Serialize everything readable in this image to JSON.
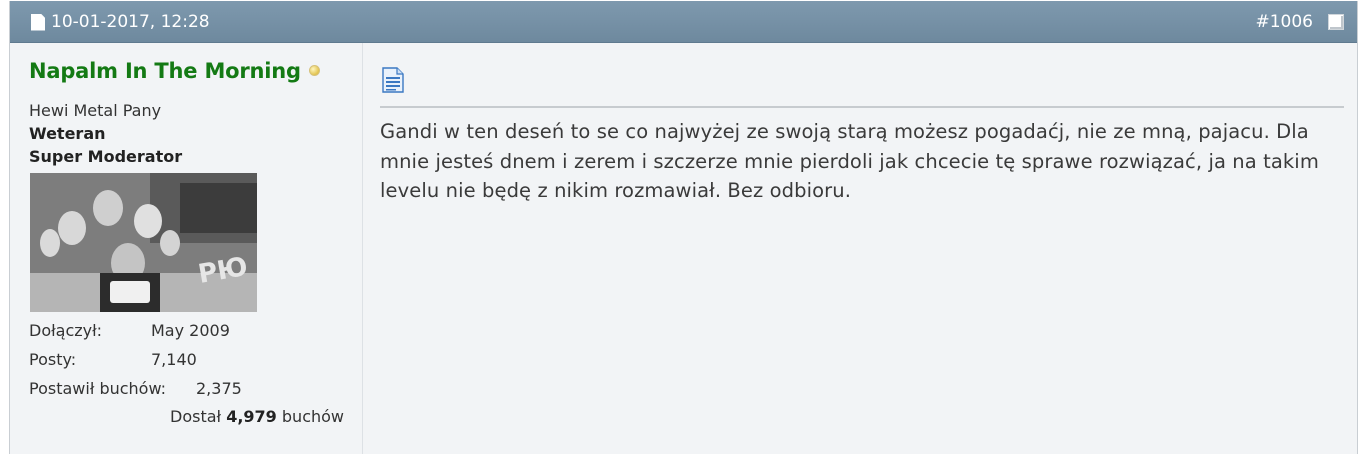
{
  "post": {
    "date": "10-01-2017, 12:28",
    "number": "#1006",
    "message": "Gandi w ten deseń to se co najwyżej ze swoją starą możesz pogadaćj, nie ze mną, pajacu. Dla mnie jesteś dnem i zerem i szczerze mnie pierdoli jak chcecie tę sprawe rozwiązać, ja na takim levelu nie będę z nikim rozmawiał. Bez odbioru."
  },
  "user": {
    "name": "Napalm In The Morning",
    "name_color": "#147a14",
    "title": "Hewi Metal Pany",
    "rank1": "Weteran",
    "rank2": "Super Moderator",
    "stats": {
      "joined_label": "Dołączył:",
      "joined_value": "May 2009",
      "posts_label": "Posty:",
      "posts_value": "7,140",
      "gave_label": "Postawił buchów:",
      "gave_value": "2,375",
      "received_prefix": "Dostał",
      "received_value": "4,979",
      "received_suffix": "buchów"
    }
  },
  "colors": {
    "header_bg": "#7590a5",
    "body_bg": "#f2f4f6",
    "online": "#e2c34e"
  }
}
